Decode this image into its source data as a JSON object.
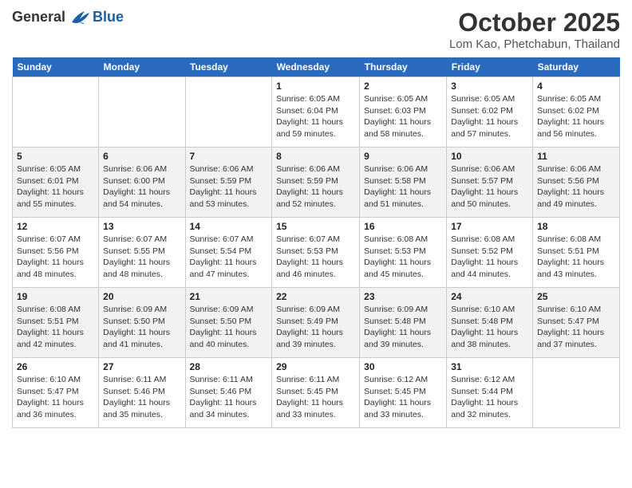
{
  "header": {
    "logo_general": "General",
    "logo_blue": "Blue",
    "month": "October 2025",
    "location": "Lom Kao, Phetchabun, Thailand"
  },
  "weekdays": [
    "Sunday",
    "Monday",
    "Tuesday",
    "Wednesday",
    "Thursday",
    "Friday",
    "Saturday"
  ],
  "weeks": [
    [
      {
        "day": "",
        "info": ""
      },
      {
        "day": "",
        "info": ""
      },
      {
        "day": "",
        "info": ""
      },
      {
        "day": "1",
        "info": "Sunrise: 6:05 AM\nSunset: 6:04 PM\nDaylight: 11 hours\nand 59 minutes."
      },
      {
        "day": "2",
        "info": "Sunrise: 6:05 AM\nSunset: 6:03 PM\nDaylight: 11 hours\nand 58 minutes."
      },
      {
        "day": "3",
        "info": "Sunrise: 6:05 AM\nSunset: 6:02 PM\nDaylight: 11 hours\nand 57 minutes."
      },
      {
        "day": "4",
        "info": "Sunrise: 6:05 AM\nSunset: 6:02 PM\nDaylight: 11 hours\nand 56 minutes."
      }
    ],
    [
      {
        "day": "5",
        "info": "Sunrise: 6:05 AM\nSunset: 6:01 PM\nDaylight: 11 hours\nand 55 minutes."
      },
      {
        "day": "6",
        "info": "Sunrise: 6:06 AM\nSunset: 6:00 PM\nDaylight: 11 hours\nand 54 minutes."
      },
      {
        "day": "7",
        "info": "Sunrise: 6:06 AM\nSunset: 5:59 PM\nDaylight: 11 hours\nand 53 minutes."
      },
      {
        "day": "8",
        "info": "Sunrise: 6:06 AM\nSunset: 5:59 PM\nDaylight: 11 hours\nand 52 minutes."
      },
      {
        "day": "9",
        "info": "Sunrise: 6:06 AM\nSunset: 5:58 PM\nDaylight: 11 hours\nand 51 minutes."
      },
      {
        "day": "10",
        "info": "Sunrise: 6:06 AM\nSunset: 5:57 PM\nDaylight: 11 hours\nand 50 minutes."
      },
      {
        "day": "11",
        "info": "Sunrise: 6:06 AM\nSunset: 5:56 PM\nDaylight: 11 hours\nand 49 minutes."
      }
    ],
    [
      {
        "day": "12",
        "info": "Sunrise: 6:07 AM\nSunset: 5:56 PM\nDaylight: 11 hours\nand 48 minutes."
      },
      {
        "day": "13",
        "info": "Sunrise: 6:07 AM\nSunset: 5:55 PM\nDaylight: 11 hours\nand 48 minutes."
      },
      {
        "day": "14",
        "info": "Sunrise: 6:07 AM\nSunset: 5:54 PM\nDaylight: 11 hours\nand 47 minutes."
      },
      {
        "day": "15",
        "info": "Sunrise: 6:07 AM\nSunset: 5:53 PM\nDaylight: 11 hours\nand 46 minutes."
      },
      {
        "day": "16",
        "info": "Sunrise: 6:08 AM\nSunset: 5:53 PM\nDaylight: 11 hours\nand 45 minutes."
      },
      {
        "day": "17",
        "info": "Sunrise: 6:08 AM\nSunset: 5:52 PM\nDaylight: 11 hours\nand 44 minutes."
      },
      {
        "day": "18",
        "info": "Sunrise: 6:08 AM\nSunset: 5:51 PM\nDaylight: 11 hours\nand 43 minutes."
      }
    ],
    [
      {
        "day": "19",
        "info": "Sunrise: 6:08 AM\nSunset: 5:51 PM\nDaylight: 11 hours\nand 42 minutes."
      },
      {
        "day": "20",
        "info": "Sunrise: 6:09 AM\nSunset: 5:50 PM\nDaylight: 11 hours\nand 41 minutes."
      },
      {
        "day": "21",
        "info": "Sunrise: 6:09 AM\nSunset: 5:50 PM\nDaylight: 11 hours\nand 40 minutes."
      },
      {
        "day": "22",
        "info": "Sunrise: 6:09 AM\nSunset: 5:49 PM\nDaylight: 11 hours\nand 39 minutes."
      },
      {
        "day": "23",
        "info": "Sunrise: 6:09 AM\nSunset: 5:48 PM\nDaylight: 11 hours\nand 39 minutes."
      },
      {
        "day": "24",
        "info": "Sunrise: 6:10 AM\nSunset: 5:48 PM\nDaylight: 11 hours\nand 38 minutes."
      },
      {
        "day": "25",
        "info": "Sunrise: 6:10 AM\nSunset: 5:47 PM\nDaylight: 11 hours\nand 37 minutes."
      }
    ],
    [
      {
        "day": "26",
        "info": "Sunrise: 6:10 AM\nSunset: 5:47 PM\nDaylight: 11 hours\nand 36 minutes."
      },
      {
        "day": "27",
        "info": "Sunrise: 6:11 AM\nSunset: 5:46 PM\nDaylight: 11 hours\nand 35 minutes."
      },
      {
        "day": "28",
        "info": "Sunrise: 6:11 AM\nSunset: 5:46 PM\nDaylight: 11 hours\nand 34 minutes."
      },
      {
        "day": "29",
        "info": "Sunrise: 6:11 AM\nSunset: 5:45 PM\nDaylight: 11 hours\nand 33 minutes."
      },
      {
        "day": "30",
        "info": "Sunrise: 6:12 AM\nSunset: 5:45 PM\nDaylight: 11 hours\nand 33 minutes."
      },
      {
        "day": "31",
        "info": "Sunrise: 6:12 AM\nSunset: 5:44 PM\nDaylight: 11 hours\nand 32 minutes."
      },
      {
        "day": "",
        "info": ""
      }
    ]
  ]
}
